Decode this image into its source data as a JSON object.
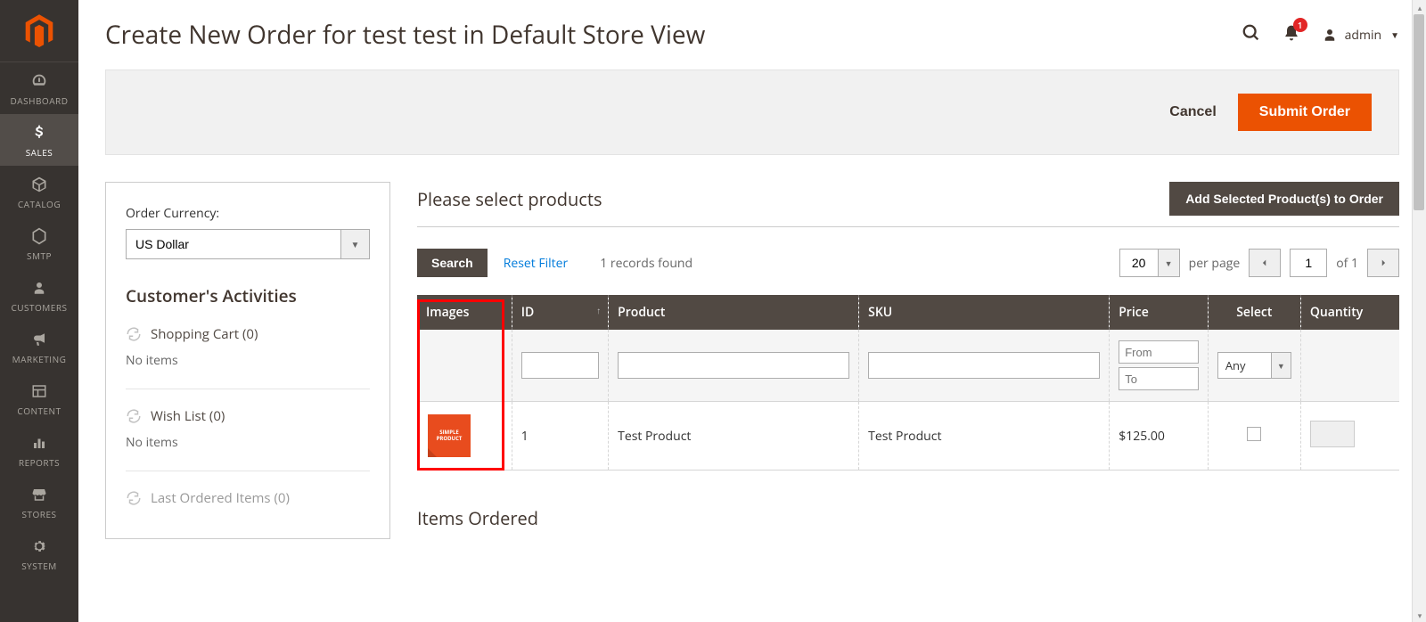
{
  "sidebar": {
    "items": [
      {
        "label": "DASHBOARD",
        "name": "nav-dashboard"
      },
      {
        "label": "SALES",
        "name": "nav-sales"
      },
      {
        "label": "CATALOG",
        "name": "nav-catalog"
      },
      {
        "label": "SMTP",
        "name": "nav-smtp"
      },
      {
        "label": "CUSTOMERS",
        "name": "nav-customers"
      },
      {
        "label": "MARKETING",
        "name": "nav-marketing"
      },
      {
        "label": "CONTENT",
        "name": "nav-content"
      },
      {
        "label": "REPORTS",
        "name": "nav-reports"
      },
      {
        "label": "STORES",
        "name": "nav-stores"
      },
      {
        "label": "SYSTEM",
        "name": "nav-system"
      }
    ]
  },
  "header": {
    "title": "Create New Order for test test in Default Store View",
    "notif_count": "1",
    "user": "admin"
  },
  "actions": {
    "cancel": "Cancel",
    "submit": "Submit Order"
  },
  "currency": {
    "label": "Order Currency:",
    "value": "US Dollar"
  },
  "activities": {
    "title": "Customer's Activities",
    "cart": "Shopping Cart (0)",
    "wishlist": "Wish List (0)",
    "last_ordered": "Last Ordered Items (0)",
    "no_items": "No items"
  },
  "products": {
    "title": "Please select products",
    "add_button": "Add Selected Product(s) to Order",
    "search": "Search",
    "reset": "Reset Filter",
    "records": "1 records found",
    "per_page_value": "20",
    "per_page_label": "per page",
    "page": "1",
    "of_label": "of 1",
    "columns": {
      "images": "Images",
      "id": "ID",
      "product": "Product",
      "sku": "SKU",
      "price": "Price",
      "select": "Select",
      "qty": "Quantity"
    },
    "filters": {
      "from": "From",
      "to": "To",
      "any": "Any"
    },
    "rows": [
      {
        "thumb": "SIMPLE PRODUCT",
        "id": "1",
        "product": "Test Product",
        "sku": "Test Product",
        "price": "$125.00"
      }
    ]
  },
  "items_ordered": {
    "title": "Items Ordered"
  }
}
